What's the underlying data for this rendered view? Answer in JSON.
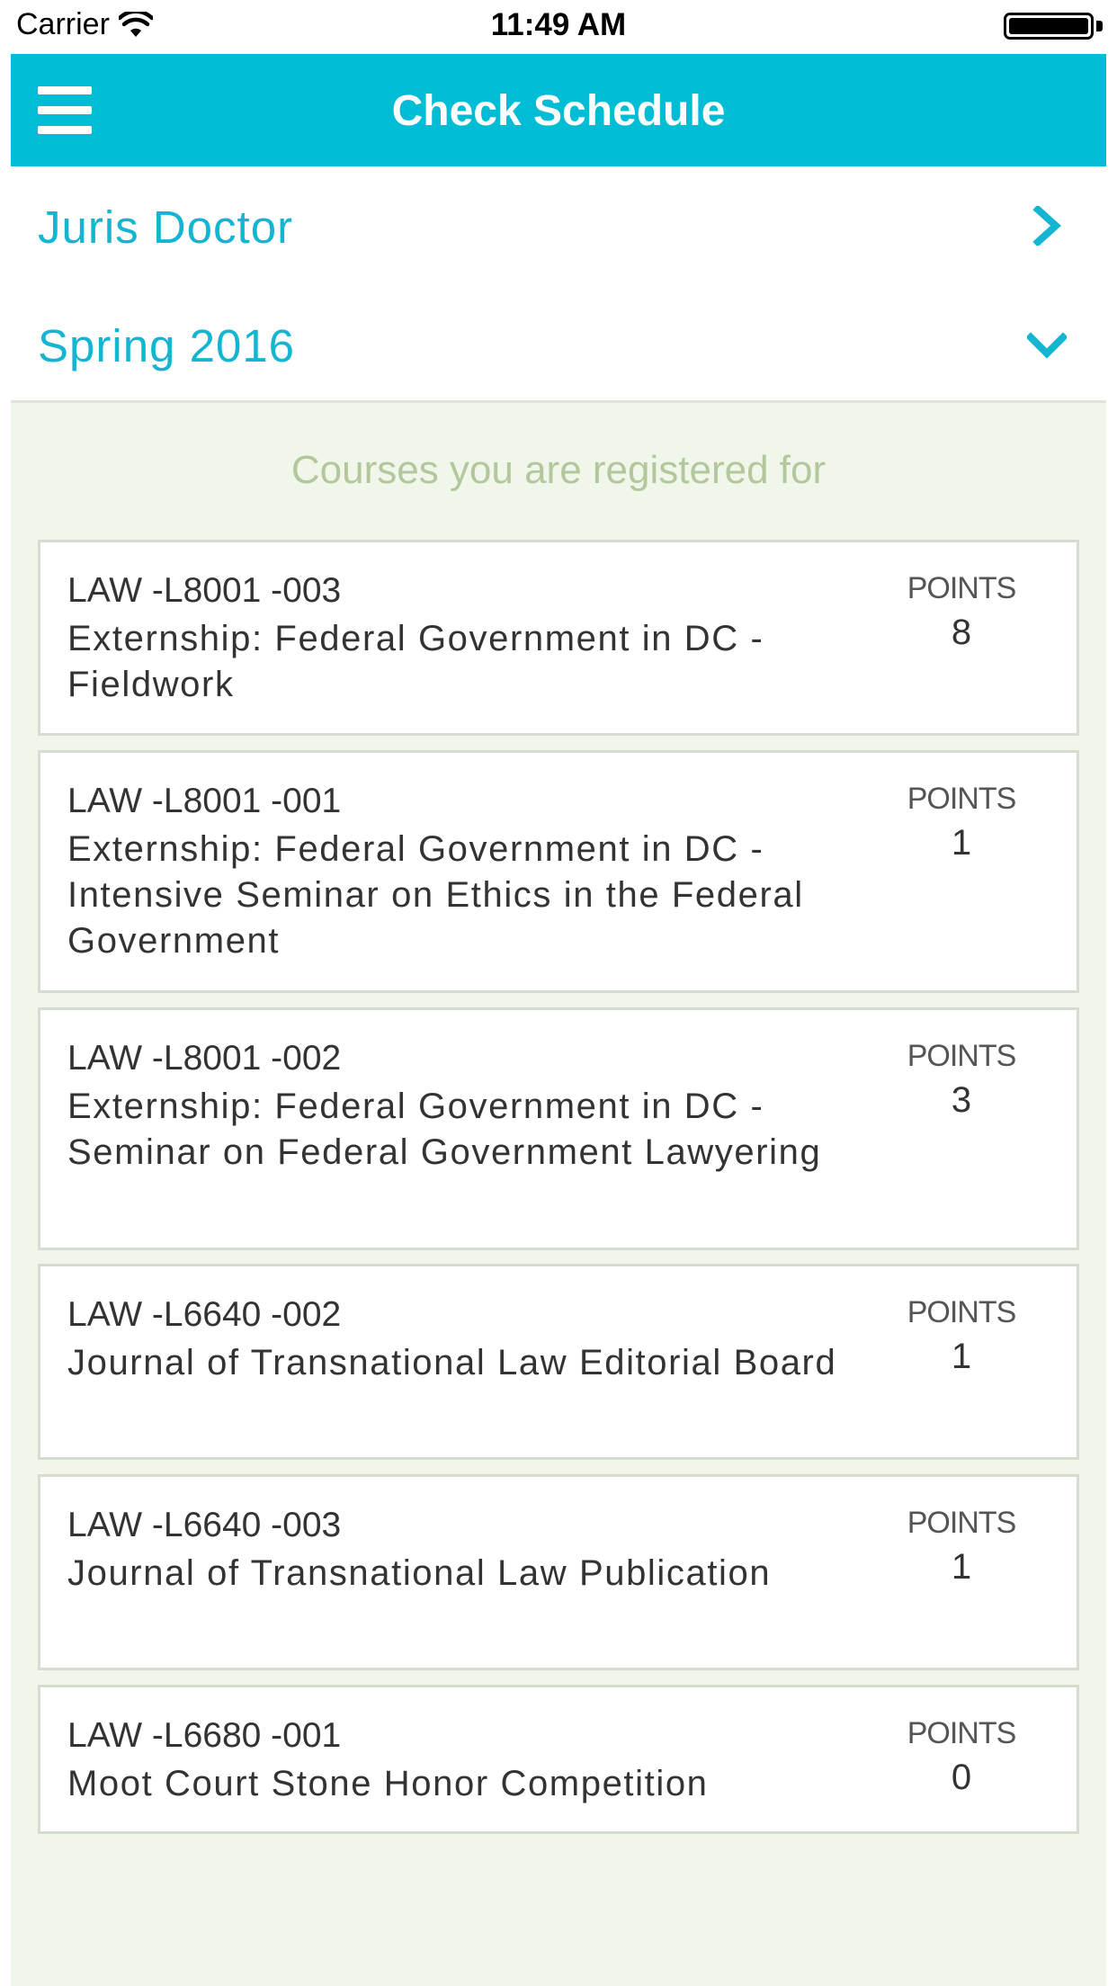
{
  "status_bar": {
    "carrier": "Carrier",
    "time": "11:49 AM"
  },
  "header": {
    "title": "Check Schedule",
    "menu_icon": "hamburger-menu-icon"
  },
  "program": {
    "label": "Juris Doctor",
    "icon": "chevron-right-icon"
  },
  "term": {
    "label": "Spring 2016",
    "icon": "chevron-down-icon"
  },
  "courses": {
    "heading": "Courses you are registered for",
    "points_label": "POINTS",
    "items": [
      {
        "code": "LAW -L8001 -003",
        "title": "Externship: Federal Government in DC - Fieldwork",
        "points": "8"
      },
      {
        "code": "LAW -L8001 -001",
        "title": "Externship: Federal Government in DC - Intensive Seminar on Ethics in the Federal Government",
        "points": "1"
      },
      {
        "code": "LAW -L8001 -002",
        "title": "Externship: Federal Government in DC - Seminar on Federal Government Lawyering",
        "points": "3"
      },
      {
        "code": "LAW -L6640 -002",
        "title": "Journal of Transnational Law Editorial Board",
        "points": "1"
      },
      {
        "code": "LAW -L6640 -003",
        "title": "Journal of Transnational Law Publication",
        "points": "1"
      },
      {
        "code": "LAW -L6680 -001",
        "title": "Moot Court Stone Honor Competition",
        "points": "0"
      }
    ]
  },
  "colors": {
    "accent": "#00bcd4",
    "link": "#14b5d0",
    "panel_background": "#f1f6ea",
    "heading_muted": "#b3c79c"
  }
}
